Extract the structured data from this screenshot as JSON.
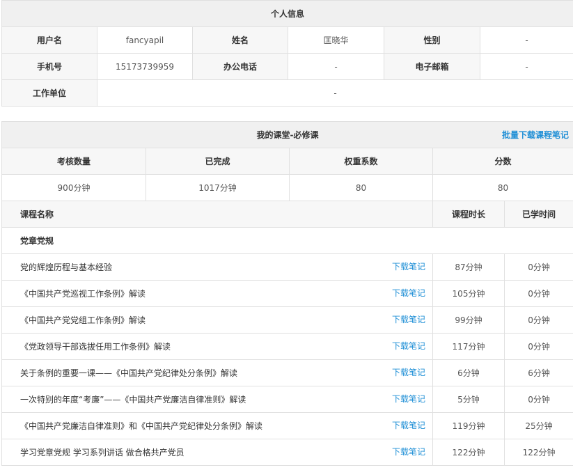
{
  "personal": {
    "title": "个人信息",
    "username_label": "用户名",
    "username": "fancyapil",
    "name_label": "姓名",
    "name": "匡晓华",
    "gender_label": "性别",
    "gender": "-",
    "phone_label": "手机号",
    "phone": "15173739959",
    "office_phone_label": "办公电话",
    "office_phone": "-",
    "email_label": "电子邮箱",
    "email": "-",
    "workplace_label": "工作单位",
    "workplace": "-"
  },
  "course": {
    "title": "我的课堂-必修课",
    "batch_download": "批量下载课程笔记",
    "stats_headers": [
      "考核数量",
      "已完成",
      "权重系数",
      "分数"
    ],
    "stats_values": [
      "900分钟",
      "1017分钟",
      "80",
      "80"
    ],
    "col_name": "课程名称",
    "col_duration": "课程时长",
    "col_learned": "已学时间",
    "category": "党章党规",
    "download_label": "下载笔记",
    "rows": [
      {
        "name": "党的辉煌历程与基本经验",
        "duration": "87分钟",
        "learned": "0分钟"
      },
      {
        "name": "《中国共产党巡视工作条例》解读",
        "duration": "105分钟",
        "learned": "0分钟"
      },
      {
        "name": "《中国共产党党组工作条例》解读",
        "duration": "99分钟",
        "learned": "0分钟"
      },
      {
        "name": "《党政领导干部选拔任用工作条例》解读",
        "duration": "117分钟",
        "learned": "0分钟"
      },
      {
        "name": "关于条例的重要一课——《中国共产党纪律处分条例》解读",
        "duration": "6分钟",
        "learned": "6分钟"
      },
      {
        "name": "一次特别的年度“考廉”——《中国共产党廉洁自律准则》解读",
        "duration": "5分钟",
        "learned": "0分钟"
      },
      {
        "name": "《中国共产党廉洁自律准则》和《中国共产党纪律处分条例》解读",
        "duration": "119分钟",
        "learned": "25分钟"
      },
      {
        "name": "学习党章党规 学习系列讲话 做合格共产党员",
        "duration": "122分钟",
        "learned": "122分钟"
      }
    ]
  }
}
